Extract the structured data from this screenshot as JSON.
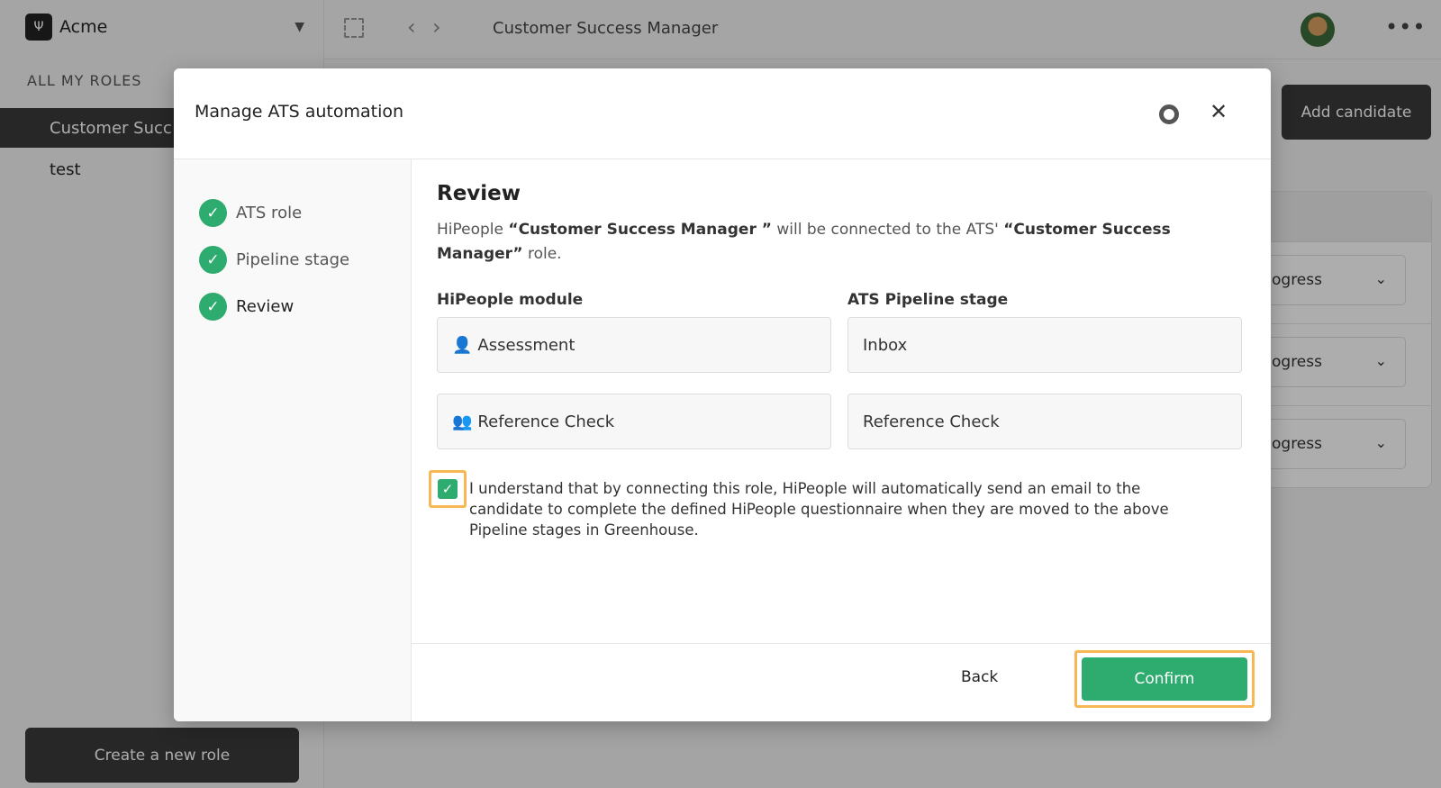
{
  "sidebar": {
    "org_name": "Acme",
    "org_logo": "Ψ",
    "roles_heading": "ALL MY ROLES",
    "roles": [
      {
        "label": "Customer Succ"
      },
      {
        "label": "test"
      }
    ],
    "new_role_label": "Create a new role"
  },
  "topbar": {
    "title": "Customer Success Manager",
    "back_glyph": "‹",
    "forward_glyph": "›",
    "more_glyph": "•••"
  },
  "main": {
    "add_candidate_label": "Add candidate",
    "status_values": [
      "ogress",
      "ogress",
      "ogress"
    ],
    "chevron_glyph": "⌄"
  },
  "modal": {
    "title": "Manage ATS automation",
    "close_glyph": "✕",
    "steps": [
      {
        "label": "ATS role",
        "check": "✓"
      },
      {
        "label": "Pipeline stage",
        "check": "✓"
      },
      {
        "label": "Review",
        "check": "✓"
      }
    ],
    "review": {
      "title": "Review",
      "desc_prefix": "HiPeople ",
      "hipeople_role": "“Customer Success Manager ”",
      "desc_middle": " will be connected to the ATS' ",
      "ats_role": "“Customer Success Manager”",
      "desc_suffix": " role.",
      "module_heading": "HiPeople module",
      "stage_heading": "ATS Pipeline stage",
      "modules": [
        {
          "icon": "👤",
          "label": "Assessment",
          "stage": "Inbox"
        },
        {
          "icon": "👥",
          "label": "Reference Check",
          "stage": "Reference Check"
        }
      ],
      "consent_check": "✓",
      "consent_text": "I understand that by connecting this role, HiPeople will automatically send an email to the candidate to complete the defined HiPeople questionnaire when they are moved to the above Pipeline stages in Greenhouse."
    },
    "back_label": "Back",
    "confirm_label": "Confirm"
  },
  "colors": {
    "accent_green": "#2eab6e",
    "highlight_orange": "#f6b754",
    "dark_button": "#3a3a3a"
  }
}
